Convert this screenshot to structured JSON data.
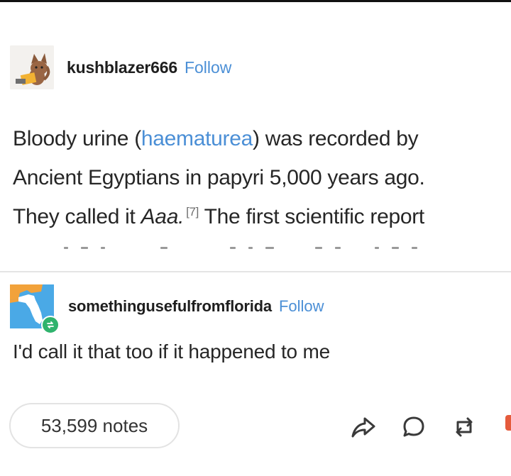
{
  "post": {
    "username": "kushblazer666",
    "follow_label": "Follow",
    "avatar_icon": "cat-avatar-icon",
    "text": {
      "line1_pre": "Bloody urine (",
      "line1_link": "haematurea",
      "line1_post": ") was recorded by",
      "line2": "Ancient Egyptians in papyri 5,000 years ago.",
      "line3_pre": "They called it ",
      "line3_italic": "Aaa.",
      "line3_citation": "[7]",
      "line3_post": " The first scientific report"
    }
  },
  "reply": {
    "username": "somethingusefulfromflorida",
    "follow_label": "Follow",
    "avatar_icon": "florida-map-avatar-icon",
    "text": "I'd call it that too if it happened to me"
  },
  "footer": {
    "notes_label": "53,599 notes",
    "actions": [
      "share-icon",
      "comment-icon",
      "reblog-icon",
      "like-icon"
    ]
  },
  "colors": {
    "link": "#4b8fd6",
    "text": "#262626",
    "divider": "#e4e4e4",
    "reblog_badge": "#2fb36d"
  }
}
